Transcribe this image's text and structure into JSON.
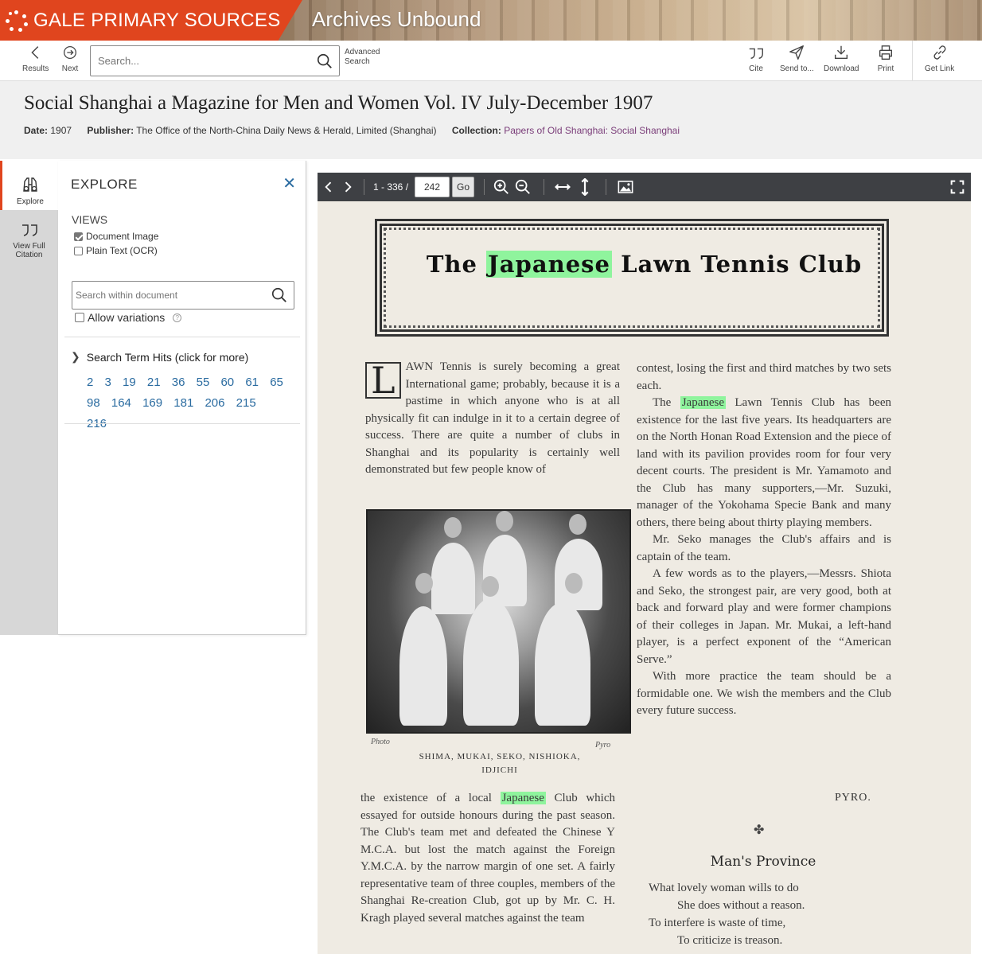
{
  "banner": {
    "brand": "GALE PRIMARY SOURCES",
    "product": "Archives Unbound",
    "brand_color": "#e0451e"
  },
  "toolbar": {
    "results_label": "Results",
    "next_label": "Next",
    "search_placeholder": "Search...",
    "advanced_line1": "Advanced",
    "advanced_line2": "Search",
    "cite_label": "Cite",
    "send_label": "Send to...",
    "download_label": "Download",
    "print_label": "Print",
    "getlink_label": "Get Link"
  },
  "document": {
    "title": "Social Shanghai a Magazine for Men and Women Vol. IV July-December 1907",
    "date_label": "Date:",
    "date_value": "1907",
    "publisher_label": "Publisher:",
    "publisher_value": "The Office of the North-China Daily News & Herald, Limited (Shanghai)",
    "collection_label": "Collection:",
    "collection_value": "Papers of Old Shanghai: Social Shanghai"
  },
  "rail": {
    "explore_label": "Explore",
    "citation_line1": "View Full",
    "citation_line2": "Citation"
  },
  "explore": {
    "title": "EXPLORE",
    "close": "✕",
    "views_label": "VIEWS",
    "view_image": "Document Image",
    "view_ocr": "Plain Text (OCR)",
    "within_placeholder": "Search within document",
    "allow_variations": "Allow variations",
    "help": "?",
    "hits_heading": "Search Term Hits (click for more)",
    "hits": [
      "2",
      "3",
      "19",
      "21",
      "36",
      "55",
      "60",
      "61",
      "65",
      "98",
      "164",
      "169",
      "181",
      "206",
      "215",
      "216"
    ]
  },
  "viewer": {
    "page_range": "1 - 336 /",
    "page_value": "242",
    "go_label": "Go"
  },
  "page": {
    "title_pre": "The",
    "title_hl": "Japanese",
    "title_post": "Lawn Tennis Club",
    "dropcap": "L",
    "left_top": "AWN Tennis is surely becoming a great International game; probably, because it is a pastime in which anyone who is at all physically fit can indulge in it to a certain degree of success. There are quite a number of clubs in Shanghai and its popularity is certainly well demonstrated but few people know of",
    "photo_credit_left": "Photo",
    "photo_credit_right": "Pyro",
    "photo_caption_1": "SHIMA, MUKAI, SEKO, NISHIOKA,",
    "photo_caption_2": "IDJICHI",
    "left_bot_pre": "the existence of a local",
    "left_bot_hl": "Japanese",
    "left_bot_post": "Club which essayed for outside honours during the past season. The Club's team met and defeated the Chinese Y M.C.A. but lost the match against the Foreign Y.M.C.A. by the narrow margin of one set. A fairly representative team of three couples, members of the Shanghai Re-creation Club, got up by Mr. C. H. Kragh played several matches against the team",
    "right_1": "contest, losing the first and third matches by two sets each.",
    "right_2_pre": "The",
    "right_2_hl": "Japanese",
    "right_2_post": "Lawn Tennis Club has been existence for the last five years. Its headquarters are on the North Honan Road Extension and the piece of land with its pavilion provides room for four very decent courts. The president is Mr. Yamamoto and the Club has many supporters,—Mr. Suzuki, manager of the Yokohama Specie Bank and many others, there being about thirty playing members.",
    "right_3": "Mr. Seko manages the Club's affairs and is captain of the team.",
    "right_4": "A few words as to the players,—Messrs. Shiota and Seko, the strongest pair, are very good, both at back and forward play and were former champions of their colleges in Japan. Mr. Mukai, a left-hand player, is a perfect exponent of the “American Serve.”",
    "right_5": "With more practice the team should be a formidable one. We wish the members and the Club every future success.",
    "signoff": "PYRO.",
    "fleuron": "✤",
    "poem_title": "Man's Province",
    "poem": [
      "What lovely woman wills to do",
      "She does without a reason.",
      "To interfere is waste of time,",
      "To criticize is treason."
    ]
  }
}
